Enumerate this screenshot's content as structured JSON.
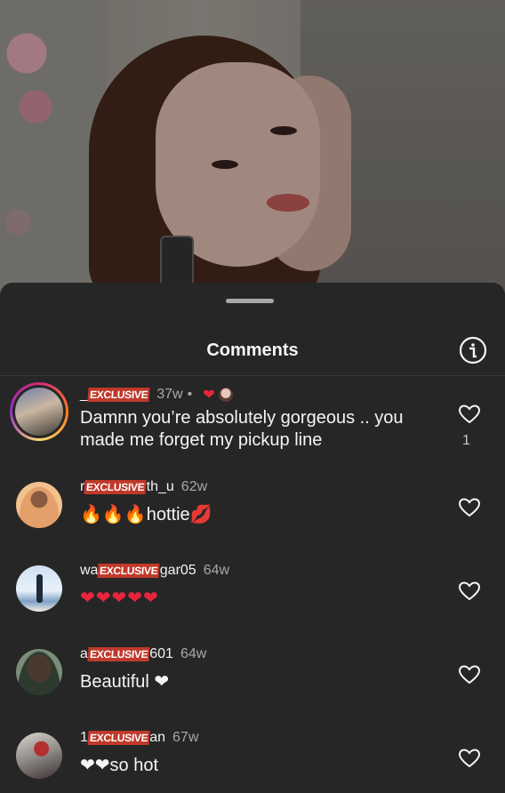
{
  "sheet": {
    "title": "Comments"
  },
  "comments": [
    {
      "user_prefix": "_",
      "tag": "EXCLUSIVE",
      "user_suffix": "",
      "time": "37w",
      "dot": "•",
      "liked_by": "❤",
      "text": "Damnn you’re absolutely gorgeous .. you made me forget my pickup line",
      "likes": "1"
    },
    {
      "user_prefix": "r",
      "tag": "EXCLUSIVE",
      "user_suffix": "th_u",
      "time": "62w",
      "text": "🔥🔥🔥hottie💋"
    },
    {
      "user_prefix": "wa",
      "tag": "EXCLUSIVE",
      "user_suffix": "gar05",
      "time": "64w",
      "text": "❤❤❤❤❤"
    },
    {
      "user_prefix": "a",
      "tag": "EXCLUSIVE",
      "user_suffix": "601",
      "time": "64w",
      "text": "Beautiful ❤"
    },
    {
      "user_prefix": "1",
      "tag": "EXCLUSIVE",
      "user_suffix": "an",
      "time": "67w",
      "text": "❤❤so hot"
    }
  ]
}
